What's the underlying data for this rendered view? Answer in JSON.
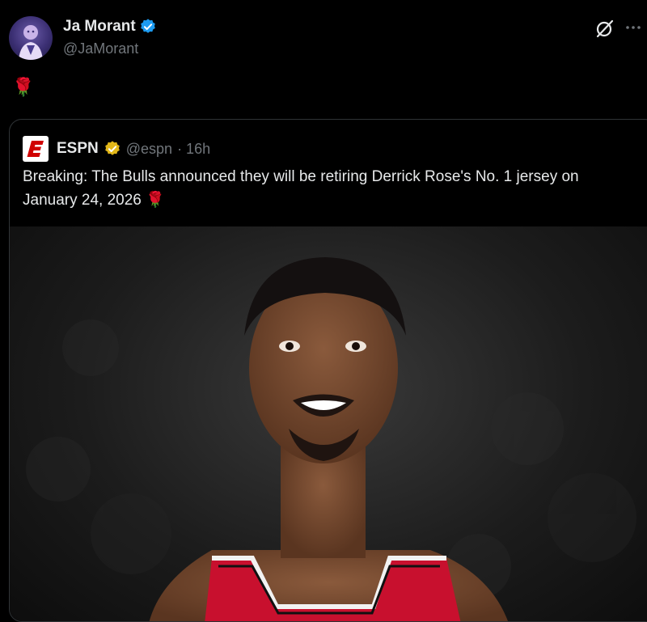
{
  "author": {
    "display_name": "Ja Morant",
    "handle": "@JaMorant",
    "verified_color": "#1d9bf0"
  },
  "tweet": {
    "text": "🌹"
  },
  "quoted_tweet": {
    "display_name": "ESPN",
    "handle": "@espn",
    "time": "· 16h",
    "verified_color": "#e2b719",
    "text": "Breaking: The Bulls announced they will be retiring Derrick Rose's No. 1 jersey on January 24, 2026 🌹"
  },
  "icons": {
    "grok": "grok-icon",
    "more": "more-icon",
    "verified": "verified-badge-icon",
    "brand": "espn-logo-icon"
  },
  "colors": {
    "background": "#000000",
    "text_primary": "#e7e9ea",
    "text_secondary": "#71767b",
    "border": "#2f3336",
    "espn_red": "#d00000"
  }
}
